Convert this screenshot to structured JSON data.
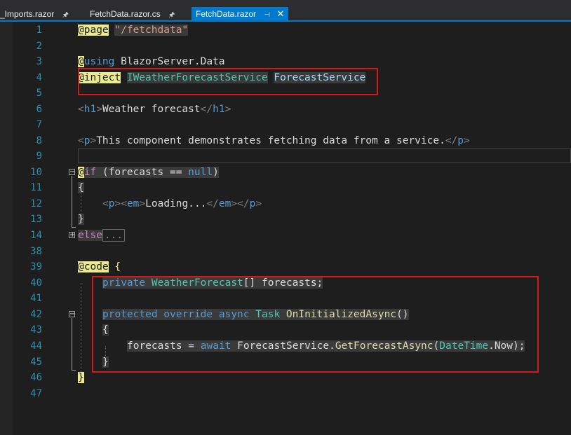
{
  "tabs": [
    {
      "label": "_Imports.razor",
      "pin": "🖈"
    },
    {
      "label": "FetchData.razor.cs",
      "pin": "🖈"
    },
    {
      "label": "FetchData.razor",
      "pin": "⊣",
      "close": "✕"
    }
  ],
  "line_numbers": [
    "1",
    "2",
    "3",
    "4",
    "5",
    "6",
    "7",
    "8",
    "9",
    "10",
    "11",
    "12",
    "13",
    "14",
    "38",
    "39",
    "40",
    "41",
    "42",
    "43",
    "44",
    "45",
    "46",
    "47"
  ],
  "code": {
    "l1": {
      "dir": "@page",
      "str": "\"/fetchdata\""
    },
    "l3": {
      "at": "@",
      "kw": "using",
      "rest": " BlazorServer.Data"
    },
    "l4": {
      "dir": "@inject",
      "type": "IWeatherForecastService",
      "name": "ForecastService"
    },
    "l6": {
      "open": "<",
      "tag": "h1",
      "close": ">",
      "text": "Weather forecast",
      "eopen": "</",
      "etag": "h1",
      "eclose": ">"
    },
    "l8": {
      "open": "<",
      "tag": "p",
      "close": ">",
      "text": "This component demonstrates fetching data from a service.",
      "eopen": "</",
      "etag": "p",
      "eclose": ">"
    },
    "l10": {
      "at": "@",
      "kw": "if",
      "cond_pre": " (forecasts == ",
      "null": "null",
      "cond_post": ")"
    },
    "l11": {
      "brace": "{"
    },
    "l12": {
      "p1": "<",
      "t1": "p",
      "p2": "><",
      "t2": "em",
      "p3": ">",
      "text": "Loading...",
      "p4": "</",
      "t3": "em",
      "p5": "></",
      "t4": "p",
      "p6": ">"
    },
    "l13": {
      "brace": "}"
    },
    "l14": {
      "kw": "else",
      "collapsed": "..."
    },
    "l39": {
      "dir": "@code",
      "brace": " {"
    },
    "l40": {
      "kw": "private",
      "type": "WeatherForecast",
      "rest": "[] forecasts;"
    },
    "l42": {
      "kw": "protected override async",
      "type": "Task",
      "method": "OnInitializedAsync",
      "rest": "()"
    },
    "l43": {
      "brace": "{"
    },
    "l44": {
      "a": "forecasts = ",
      "kw": "await",
      "b": " ForecastService.",
      "method": "GetForecastAsync",
      "c": "(",
      "type": "DateTime",
      "d": ".Now);"
    },
    "l45": {
      "brace": "}"
    },
    "l46": {
      "brace": "}"
    }
  },
  "colors": {
    "accent": "#007acc",
    "highlight_box": "#d11a1a",
    "background": "#1e1e1e"
  }
}
